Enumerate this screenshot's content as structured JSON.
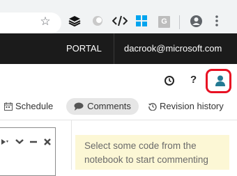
{
  "browser": {
    "extensions": [
      "layers-icon",
      "circle-icon",
      "code-icon",
      "windows-icon",
      "g-icon"
    ],
    "ext_g_letter": "G"
  },
  "header": {
    "portal_label": "PORTAL",
    "user_email": "dacrook@microsoft.com"
  },
  "utility": {
    "help_label": "?"
  },
  "tabs": [
    {
      "label": "Schedule",
      "icon": "calendar-icon"
    },
    {
      "label": "Comments",
      "icon": "comment-icon",
      "active": true
    },
    {
      "label": "Revision history",
      "icon": "history-icon"
    }
  ],
  "comment_panel": {
    "text": "Select some code from the notebook to start commenting"
  },
  "colors": {
    "header_bg": "#1b1b1b",
    "highlight": "#e81123",
    "accent_teal": "#237a93",
    "hint_bg": "#fcf7d5"
  }
}
